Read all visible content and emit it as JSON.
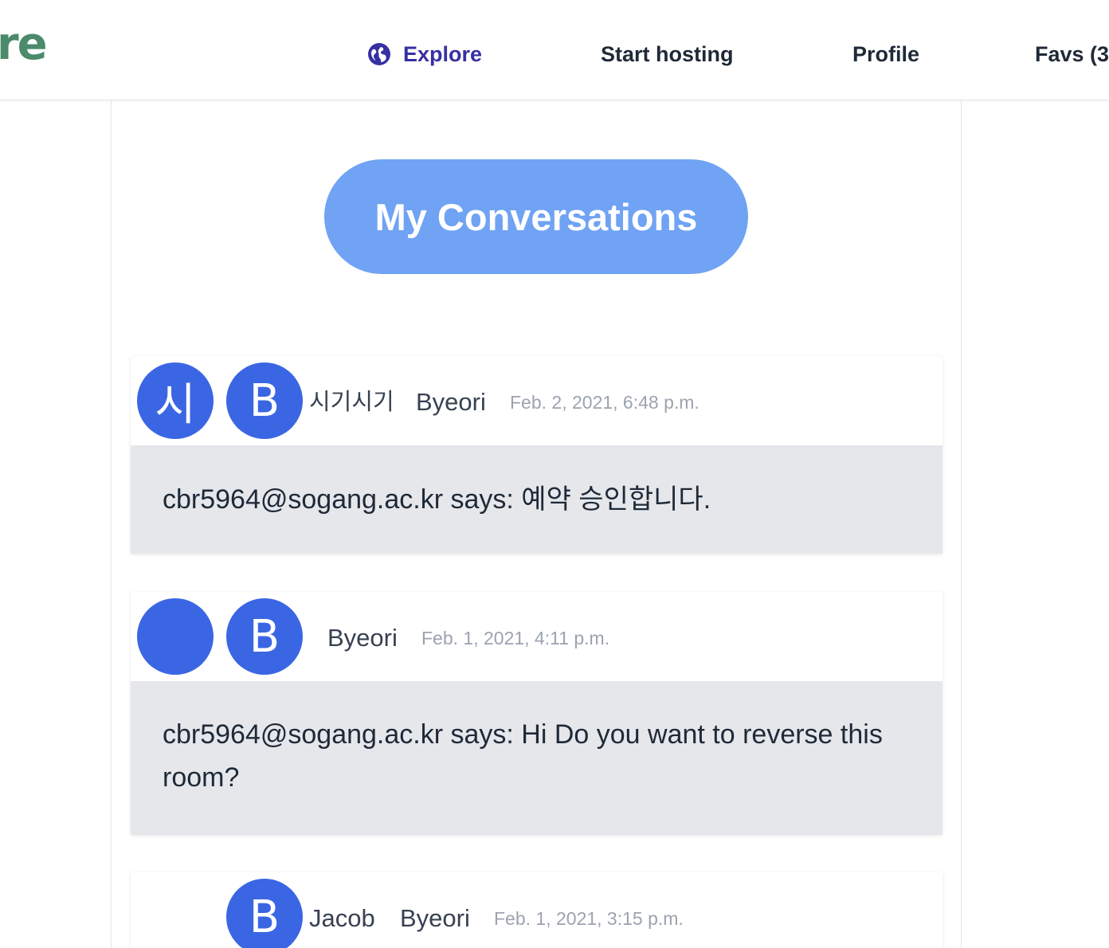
{
  "navbar": {
    "logo_text": "re",
    "items": [
      {
        "label": "Explore",
        "icon": "globe-icon",
        "active": true
      },
      {
        "label": "Start hosting"
      },
      {
        "label": "Profile"
      },
      {
        "label": "Favs (3"
      }
    ]
  },
  "heading": "My Conversations",
  "conversations": [
    {
      "participants": [
        {
          "initial": "시",
          "name": "시기시기"
        },
        {
          "initial": "B",
          "name": "Byeori"
        }
      ],
      "date": "Feb. 2, 2021, 6:48 p.m.",
      "last_message": "cbr5964@sogang.ac.kr says: 예약 승인합니다."
    },
    {
      "participants": [
        {
          "initial": "",
          "name": ""
        },
        {
          "initial": "B",
          "name": "Byeori"
        }
      ],
      "date": "Feb. 1, 2021, 4:11 p.m.",
      "last_message": "cbr5964@sogang.ac.kr says: Hi Do you want to reverse this room?"
    },
    {
      "participants": [
        {
          "initial": "B",
          "name": "Jacob"
        },
        {
          "initial": "",
          "name": "Byeori"
        }
      ],
      "date": "Feb. 1, 2021, 3:15 p.m."
    }
  ],
  "colors": {
    "accent_nav": "#3730a3",
    "pill": "#70a3f3",
    "avatar": "#3b66e3",
    "message_bg": "#e5e7eb",
    "logo": "#4b8a6a"
  }
}
